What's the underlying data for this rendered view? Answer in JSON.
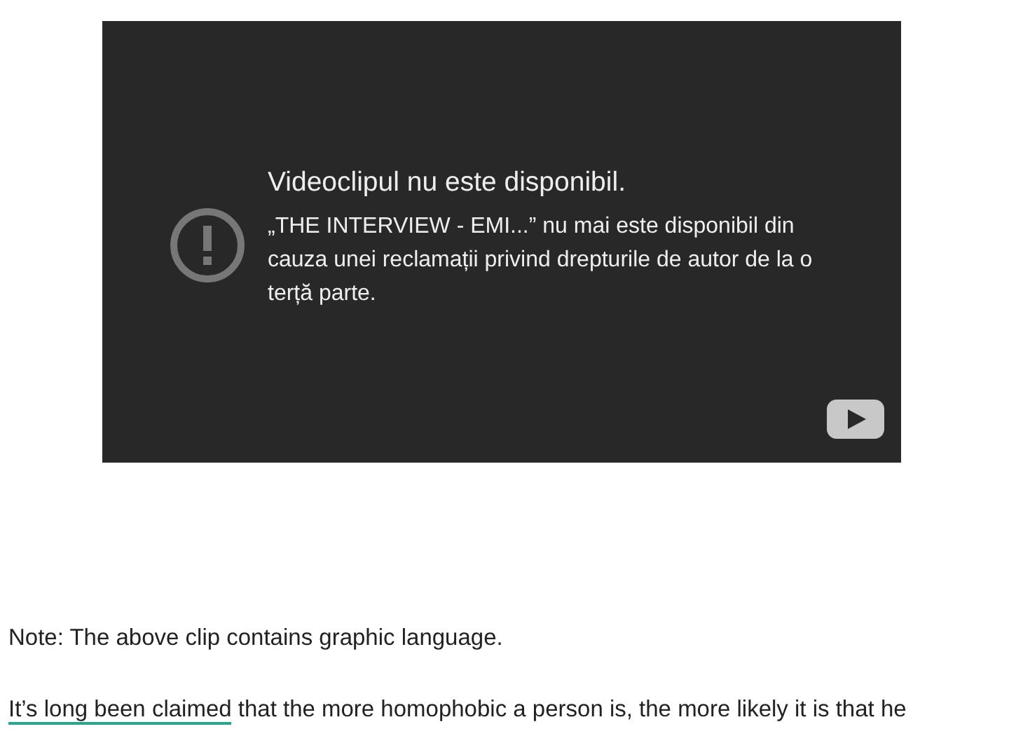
{
  "video": {
    "title": "Videoclipul nu este disponibil.",
    "message": "„THE INTERVIEW - EMI...” nu mai este disponibil din cauza unei reclamații privind drepturile de autor de la o terță parte."
  },
  "note": "Note: The above clip contains graphic language.",
  "paragraph": {
    "link": "It’s long been claimed",
    "text": " that the more homophobic a person is, the more likely it is that he"
  }
}
